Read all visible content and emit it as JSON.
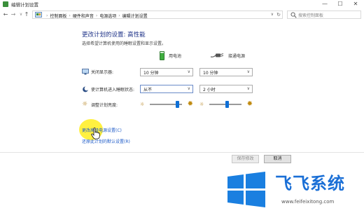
{
  "window": {
    "title": "编辑计划设置",
    "controls": [
      "—",
      "☐",
      "✕"
    ]
  },
  "address_bar": {
    "breadcrumbs": [
      "控制面板",
      "硬件和声音",
      "电源选项",
      "编辑计划设置"
    ],
    "search_placeholder": "搜索控制面板"
  },
  "plan": {
    "heading": "更改计划的设置: 高性能",
    "subheading": "选择希望计算机使用的睡眠设置和显示设置。",
    "columns": {
      "on_battery": "用电池",
      "plugged_in": "接通电源"
    },
    "settings": [
      {
        "label": "关闭显示器:",
        "on_battery": "10 分钟",
        "plugged_in": "10 分钟"
      },
      {
        "label": "使计算机进入睡眠状态:",
        "on_battery": "从不",
        "plugged_in": "2 小时"
      }
    ],
    "brightness": {
      "label": "调整计划亮度:",
      "on_battery_level": 0.85,
      "plugged_in_level": 0.55
    }
  },
  "links": {
    "advanced": "更改高级电源设置(C)",
    "restore": "还原此计划的默认设置(R)"
  },
  "buttons": {
    "save": "保存修改",
    "cancel": "取消"
  },
  "watermark": {
    "name": "飞飞系统",
    "url": "www.feifeixitong.com"
  },
  "colors": {
    "heading": "#1e3287",
    "link": "#1e5bc8",
    "slider_thumb": "#0e6fd6",
    "highlight": "#ffeb00",
    "watermark_blue": "#1a6fd6"
  }
}
